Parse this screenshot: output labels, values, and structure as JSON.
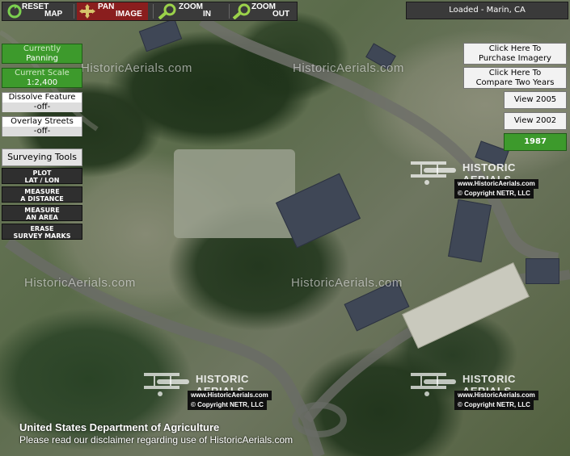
{
  "toolbar": {
    "reset": {
      "line1": "RESET",
      "line2": "MAP",
      "icon": "reset-icon"
    },
    "pan": {
      "line1": "PAN",
      "line2": "IMAGE",
      "icon": "pan-arrows-icon"
    },
    "zoom_in": {
      "line1": "ZOOM",
      "line2": "IN",
      "icon": "zoom-in-magnifier-icon"
    },
    "zoom_out": {
      "line1": "ZOOM",
      "line2": "OUT",
      "icon": "zoom-out-magnifier-icon"
    }
  },
  "status": "Loaded - Marin, CA",
  "left_panel": {
    "mode_label": "Currently",
    "mode_value": "Panning",
    "scale_label": "Current Scale",
    "scale_value": "1:2,400",
    "dissolve_label": "Dissolve Feature",
    "dissolve_value": "-off-",
    "overlay_label": "Overlay Streets",
    "overlay_value": "-off-",
    "surveying_title": "Surveying Tools",
    "tools": [
      {
        "line1": "PLOT",
        "line2": "LAT / LON"
      },
      {
        "line1": "MEASURE",
        "line2": "A DISTANCE"
      },
      {
        "line1": "MEASURE",
        "line2": "AN AREA"
      },
      {
        "line1": "ERASE",
        "line2": "SURVEY MARKS"
      }
    ]
  },
  "right_panel": {
    "purchase": {
      "line1": "Click Here To",
      "line2": "Purchase Imagery"
    },
    "compare": {
      "line1": "Click Here To",
      "line2": "Compare Two Years"
    },
    "years": [
      "View 2005",
      "View 2002",
      "1987"
    ]
  },
  "watermark": {
    "text": "HistoricAerials.com",
    "logo_title": "HISTORIC AERIALS",
    "logo_url": "www.HistoricAerials.com",
    "logo_copy": "© Copyright NETR, LLC"
  },
  "footer": {
    "line1": "United States Department of Agriculture",
    "line2": "Please read our disclaimer regarding use of HistoricAerials.com"
  },
  "colors": {
    "active_green": "#3d9a2c",
    "toolbar_dark": "#3a3a3a"
  }
}
